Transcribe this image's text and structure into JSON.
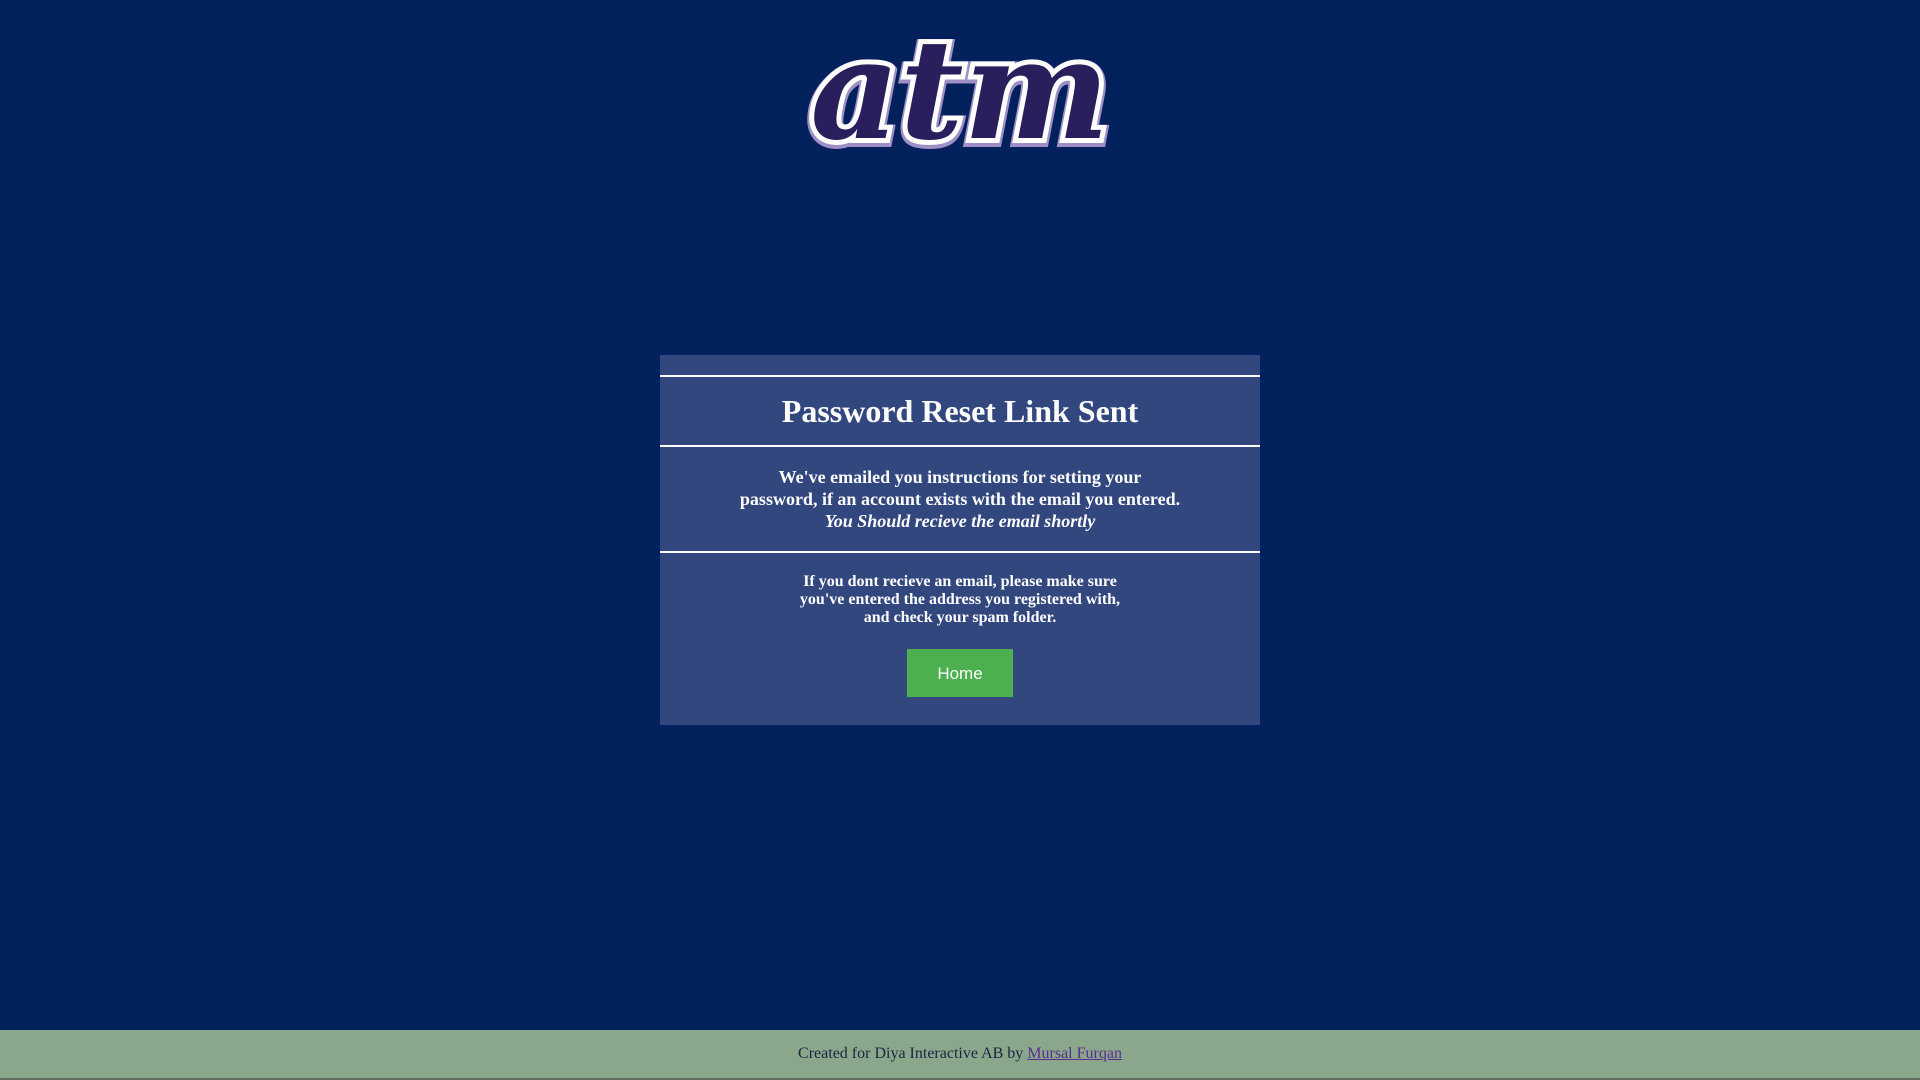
{
  "logo": {
    "text": "atm",
    "colors": {
      "fill": "#2a1f5c",
      "outline": "#ffffff",
      "shadow": "#9e8fc7"
    }
  },
  "card": {
    "title": "Password Reset Link Sent",
    "message": {
      "line1": "We've emailed you instructions for setting your",
      "line2": "password, if an account exists with the email you entered.",
      "line3": "You Should recieve the email shortly"
    },
    "help": {
      "line1": "If you dont recieve an email, please make sure",
      "line2": "you've entered the address you registered with,",
      "line3": "and check your spam folder."
    },
    "home_button_label": "Home"
  },
  "footer": {
    "prefix": "Created for Diya Interactive AB by ",
    "author_link": "Mursal Furqan"
  },
  "colors": {
    "background": "#00215c",
    "card": "#33477f",
    "button": "#4caf50",
    "footer": "#8aa78b",
    "link": "#5a2e91"
  }
}
